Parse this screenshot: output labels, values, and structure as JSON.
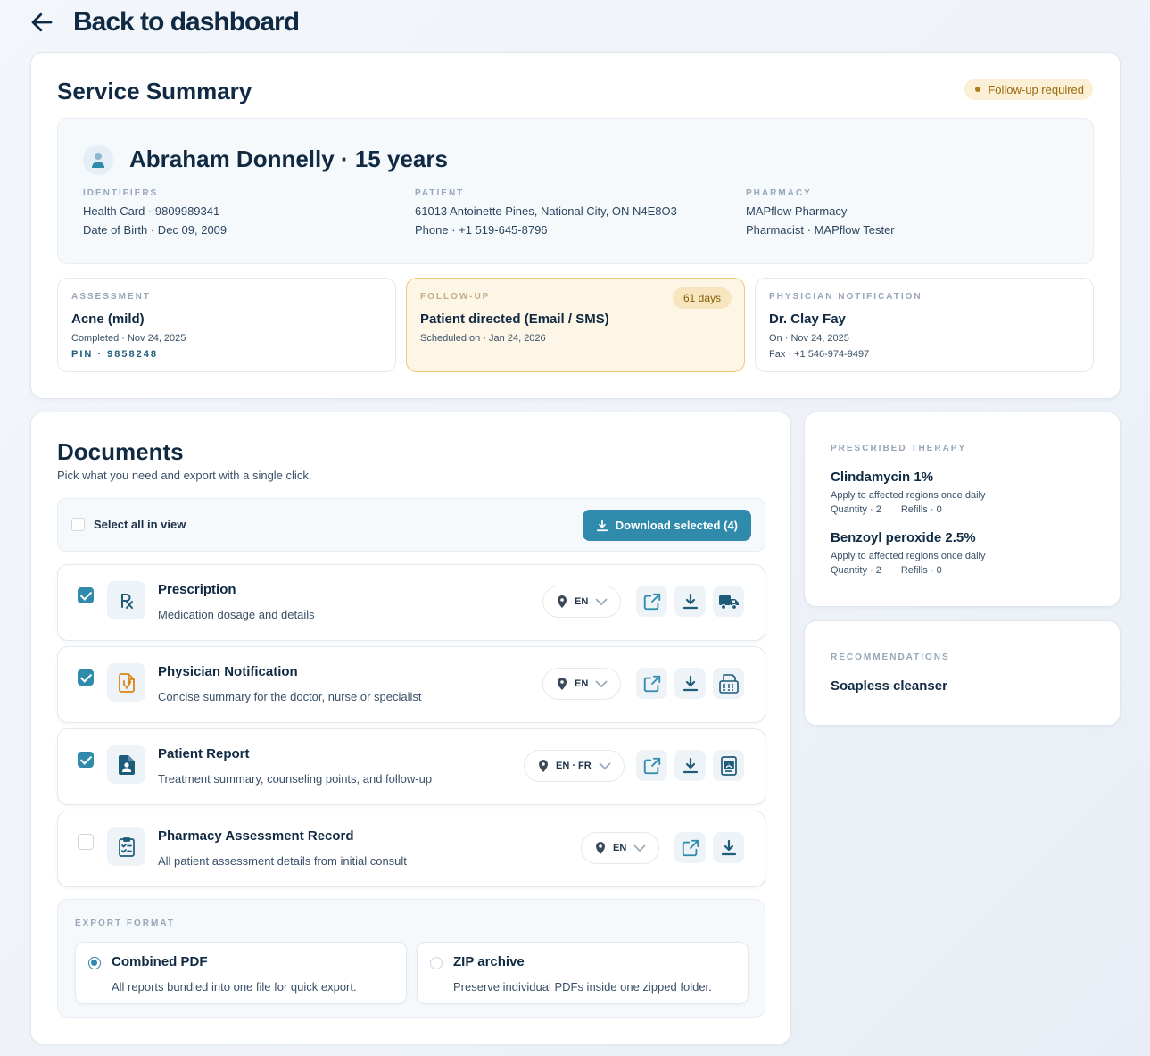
{
  "nav": {
    "back_label": "Back to dashboard"
  },
  "summary": {
    "title": "Service Summary",
    "status": "Follow-up required",
    "patient_name": "Abraham Donnelly · 15 years",
    "identifiers": {
      "label": "IDENTIFIERS",
      "line1": "Health Card · 9809989341",
      "line2": "Date of Birth · Dec 09, 2009"
    },
    "patient": {
      "label": "PATIENT",
      "line1": "61013 Antoinette Pines, National City, ON N4E8O3",
      "line2": "Phone · +1 519-645-8796"
    },
    "pharmacy": {
      "label": "PHARMACY",
      "line1": "MAPflow Pharmacy",
      "line2": "Pharmacist · MAPflow Tester"
    },
    "assessment": {
      "label": "ASSESSMENT",
      "title": "Acne (mild)",
      "line1": "Completed · Nov 24, 2025",
      "pin": "PIN · 9858248"
    },
    "followup": {
      "label": "FOLLOW-UP",
      "days": "61 days",
      "title": "Patient directed (Email / SMS)",
      "line1": "Scheduled on · Jan 24, 2026"
    },
    "physician": {
      "label": "PHYSICIAN NOTIFICATION",
      "title": "Dr. Clay Fay",
      "line1": "On · Nov 24, 2025",
      "line2": "Fax · +1 546-974-9497"
    }
  },
  "documents": {
    "title": "Documents",
    "subtitle": "Pick what you need and export with a single click.",
    "select_all_label": "Select all in view",
    "download_label": "Download selected (4)",
    "items": [
      {
        "title": "Prescription",
        "desc": "Medication dosage and details",
        "lang": "EN",
        "checked": true
      },
      {
        "title": "Physician Notification",
        "desc": "Concise summary for the doctor, nurse or specialist",
        "lang": "EN",
        "checked": true
      },
      {
        "title": "Patient Report",
        "desc": "Treatment summary, counseling points, and follow-up",
        "lang": "EN · FR",
        "checked": true
      },
      {
        "title": "Pharmacy Assessment Record",
        "desc": "All patient assessment details from initial consult",
        "lang": "EN",
        "checked": false
      }
    ],
    "export": {
      "label": "EXPORT FORMAT",
      "options": [
        {
          "title": "Combined PDF",
          "desc": "All reports bundled into one file for quick export.",
          "selected": true
        },
        {
          "title": "ZIP archive",
          "desc": "Preserve individual PDFs inside one zipped folder.",
          "selected": false
        }
      ]
    }
  },
  "therapy": {
    "label": "PRESCRIBED THERAPY",
    "items": [
      {
        "name": "Clindamycin 1%",
        "instructions": "Apply to affected regions once daily",
        "quantity": "Quantity · 2",
        "refills": "Refills · 0"
      },
      {
        "name": "Benzoyl peroxide 2.5%",
        "instructions": "Apply to affected regions once daily",
        "quantity": "Quantity · 2",
        "refills": "Refills · 0"
      }
    ]
  },
  "recommendations": {
    "label": "RECOMMENDATIONS",
    "items": [
      "Soapless cleanser"
    ]
  },
  "colors": {
    "accent": "#2f8aab",
    "navy": "#102a43",
    "followup_bg": "#fdf5e6",
    "followup_border": "#f0c77c",
    "doc_icon_orange": "#d9860f"
  },
  "icons": {
    "back": "arrow-left-icon",
    "avatar": "user-icon",
    "download": "download-icon",
    "prescription": "rx-icon",
    "physician": "stethoscope-doc-icon",
    "patient_report": "person-doc-icon",
    "assessment": "checklist-icon",
    "location": "pin-icon",
    "chevron": "chevron-down-icon",
    "open": "external-link-icon",
    "deliver": "truck-icon",
    "fax": "fax-icon",
    "print": "print-icon"
  }
}
